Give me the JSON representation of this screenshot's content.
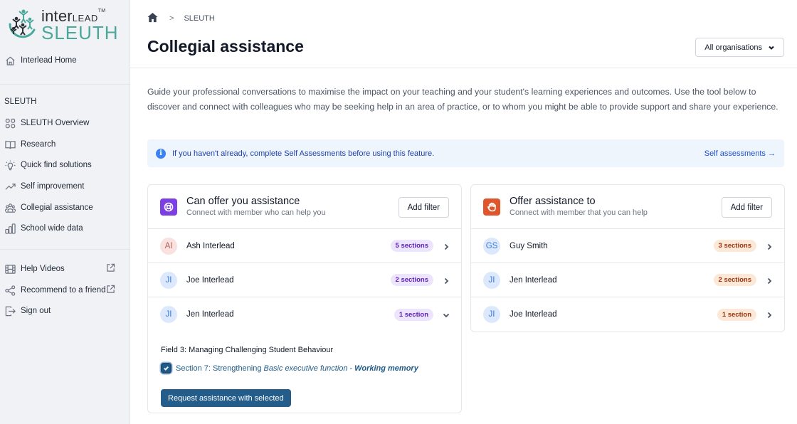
{
  "brand": {
    "logo_top": "inter",
    "logo_top_caps": "LEAD",
    "logo_tm": "TM",
    "logo_bottom": "SLEUTH",
    "colors": {
      "teal": "#4aa89a",
      "dark": "#2a2f35"
    }
  },
  "sidebar": {
    "home_item": {
      "label": "Interlead Home",
      "icon": "home-outline-icon"
    },
    "section_label": "SLEUTH",
    "items": [
      {
        "label": "SLEUTH Overview",
        "icon": "grid-icon"
      },
      {
        "label": "Research",
        "icon": "book-icon"
      },
      {
        "label": "Quick find solutions",
        "icon": "lightbulb-icon"
      },
      {
        "label": "Self improvement",
        "icon": "trending-up-icon"
      },
      {
        "label": "Collegial assistance",
        "icon": "users-icon"
      },
      {
        "label": "School wide data",
        "icon": "bar-chart-icon"
      }
    ],
    "bottom_items": [
      {
        "label": "Help Videos",
        "icon": "film-icon",
        "external": true
      },
      {
        "label": "Recommend to a friend",
        "icon": "share-icon",
        "external": true
      },
      {
        "label": "Sign out",
        "icon": "sign-out-icon",
        "external": false
      }
    ]
  },
  "header": {
    "breadcrumb": [
      "SLEUTH"
    ],
    "title": "Collegial assistance",
    "org_select": {
      "value": "All organisations"
    }
  },
  "intro": "Guide your professional conversations to maximise the impact on your teaching and your student's learning experiences and outcomes. Use the tool below to discover and connect with colleagues who may be seeking help in an area of practice, or to whom you might be able to provide support and share your experience.",
  "alert": {
    "message": "If you haven't already, complete Self Assessments before using this feature.",
    "link": "Self assessments →"
  },
  "cards": [
    {
      "title": "Can offer you assistance",
      "subtitle": "Connect with member who can help you",
      "filter_label": "Add filter",
      "icon": "lifebuoy-icon",
      "icon_color": "#7b3fe4",
      "badge_bg": "#ede4fd",
      "badge_fg": "#5b21b6",
      "rows": [
        {
          "initials": "AI",
          "name": "Ash Interlead",
          "badge": "5 sections",
          "avatar_bg": "#f8e1df",
          "avatar_fg": "#b45f58",
          "expanded": false
        },
        {
          "initials": "JI",
          "name": "Joe Interlead",
          "badge": "2 sections",
          "avatar_bg": "#dce8fb",
          "avatar_fg": "#3b7be0",
          "expanded": false
        },
        {
          "initials": "JI",
          "name": "Jen Interlead",
          "badge": "1 section",
          "avatar_bg": "#dce8fb",
          "avatar_fg": "#3b7be0",
          "expanded": true
        }
      ],
      "expanded": {
        "field_title": "Field 3: Managing Challenging Student Behaviour",
        "section_prefix": "Section 7: Strengthening",
        "section_italic": "Basic executive function",
        "section_dash": "-",
        "section_bold": "Working memory",
        "checked": true,
        "button": "Request assistance with selected"
      }
    },
    {
      "title": "Offer assistance to",
      "subtitle": "Connect with member that you can help",
      "filter_label": "Add filter",
      "icon": "hand-icon",
      "icon_color": "#e0552b",
      "badge_bg": "#fce8d6",
      "badge_fg": "#9a3412",
      "rows": [
        {
          "initials": "GS",
          "name": "Guy Smith",
          "badge": "3 sections",
          "avatar_bg": "#dce8fb",
          "avatar_fg": "#3b7be0"
        },
        {
          "initials": "JI",
          "name": "Jen Interlead",
          "badge": "2 sections",
          "avatar_bg": "#dce8fb",
          "avatar_fg": "#3b7be0"
        },
        {
          "initials": "JI",
          "name": "Joe Interlead",
          "badge": "1 section",
          "avatar_bg": "#dce8fb",
          "avatar_fg": "#3b7be0"
        }
      ]
    }
  ]
}
